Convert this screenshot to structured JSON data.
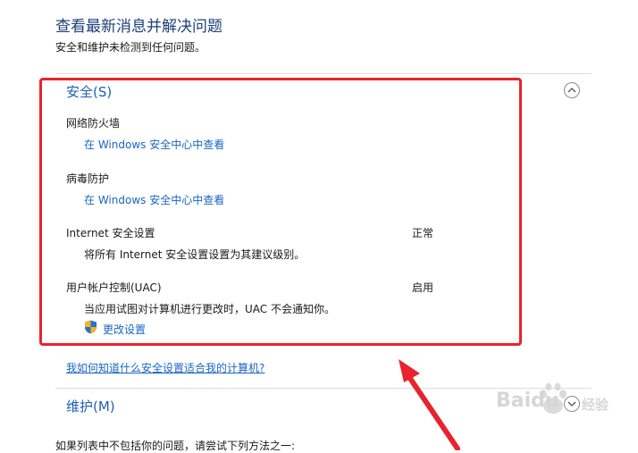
{
  "header": {
    "title": "查看最新消息并解决问题",
    "subtitle": "安全和维护未检测到任何问题。"
  },
  "security": {
    "heading": "安全(S)",
    "firewall": {
      "label": "网络防火墙",
      "link": "在 Windows 安全中心中查看"
    },
    "antivirus": {
      "label": "病毒防护",
      "link": "在 Windows 安全中心中查看"
    },
    "internet": {
      "label": "Internet 安全设置",
      "status": "正常",
      "desc": "将所有 Internet 安全设置设置为其建议级别。"
    },
    "uac": {
      "label": "用户帐户控制(UAC)",
      "status": "启用",
      "desc": "当应用试图对计算机进行更改时，UAC 不会通知你。",
      "change_link": "更改设置"
    }
  },
  "help_link": "我如何知道什么安全设置适合我的计算机?",
  "maintenance": {
    "heading": "维护(M)"
  },
  "footer_text": "如果列表中不包括你的问题，请尝试下列方法之一:",
  "watermark": {
    "brand": "Baidu",
    "sub": "经验"
  },
  "colors": {
    "accent": "#1a66c2",
    "highlight_box": "#e8232d",
    "heading": "#1e3f78"
  }
}
